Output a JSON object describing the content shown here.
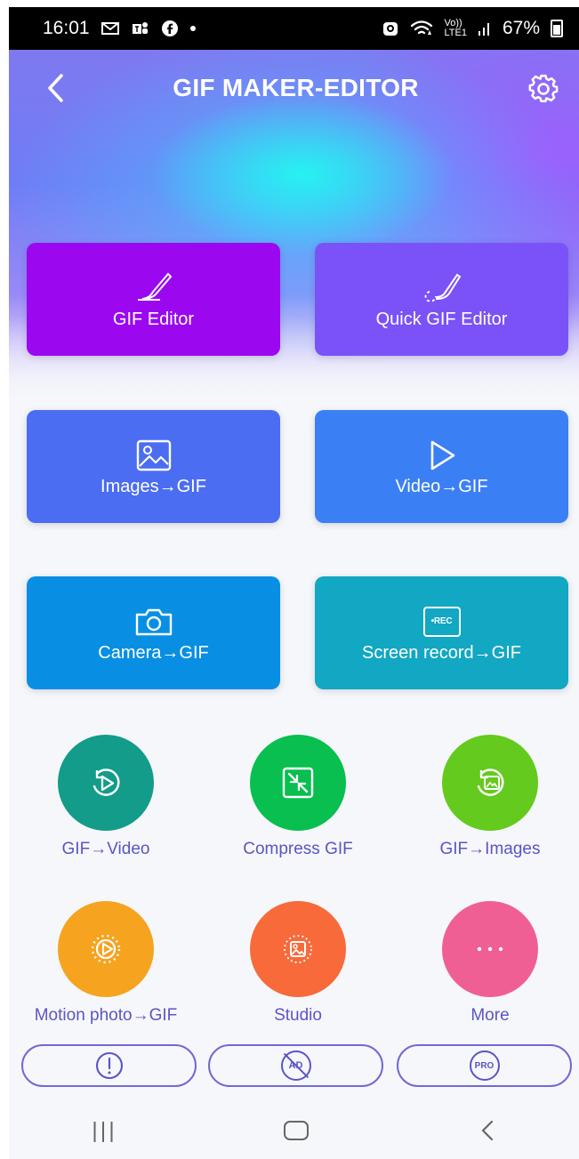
{
  "status_bar": {
    "time": "16:01",
    "left_icons": [
      "mail-icon",
      "teams-icon",
      "facebook-icon",
      "dot-indicator"
    ],
    "right_icons": [
      "alarm-icon",
      "wifi-icon",
      "volte-icon",
      "signal-icon",
      "battery-icon"
    ],
    "volte_text": "Vo))",
    "lte_text": "LTE1",
    "battery": "67%"
  },
  "header": {
    "title": "GIF MAKER-EDITOR"
  },
  "tiles": {
    "gif_editor": "GIF Editor",
    "quick_gif_editor": "Quick GIF Editor",
    "images_to_gif": "Images→GIF",
    "video_to_gif": "Video→GIF",
    "camera_to_gif": "Camera→GIF",
    "screen_record_to_gif": "Screen record→GIF",
    "rec_badge": "•REC"
  },
  "tools": {
    "gif_to_video": "GIF→Video",
    "compress_gif": "Compress GIF",
    "gif_to_images": "GIF→Images",
    "motion_photo_to_gif": "Motion photo→GIF",
    "studio": "Studio",
    "more": "More"
  },
  "bottom_actions": {
    "ad_text": "AD",
    "pro_text": "PRO"
  },
  "colors": {
    "tile_gif_editor": "#9b08f0",
    "tile_quick_editor": "#7b52f7",
    "tile_images": "#4b6df2",
    "tile_video": "#3b7ff5",
    "tile_camera": "#088fe3",
    "tile_screen_record": "#12a7c2",
    "tool_gif_video": "#139c89",
    "tool_compress": "#08bf4f",
    "tool_gif_images": "#64ca1d",
    "tool_motion": "#f6a31f",
    "tool_studio": "#f86a3a",
    "tool_more": "#f05f94",
    "tool_label": "#5a55c6"
  }
}
